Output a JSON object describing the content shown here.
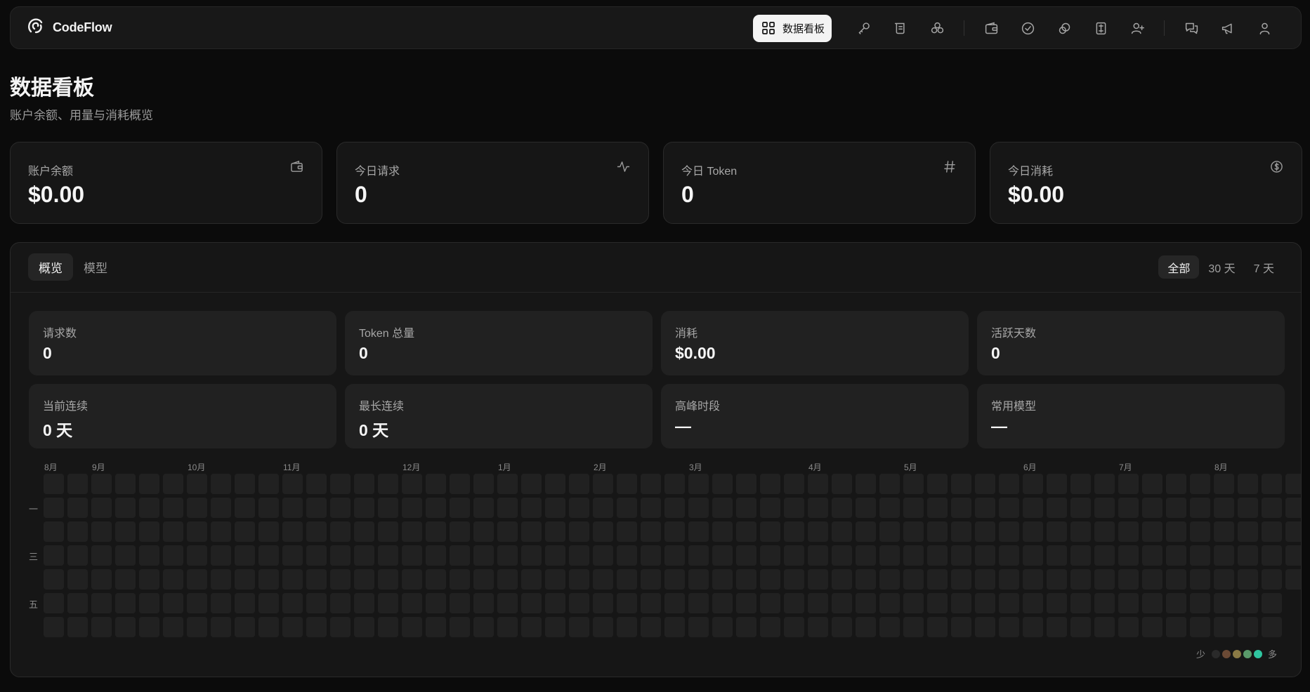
{
  "brand": {
    "name": "CodeFlow",
    "icon": "logo-icon"
  },
  "nav": {
    "active_label": "数据看板",
    "icons": [
      "key-icon",
      "scroll-icon",
      "network-icon",
      "wallet-icon",
      "check-circle-icon",
      "link-icon",
      "invoice-icon",
      "user-plus-icon",
      "chat-icon",
      "megaphone-icon",
      "user-icon"
    ]
  },
  "page": {
    "title": "数据看板",
    "subtitle": "账户余额、用量与消耗概览"
  },
  "stats": [
    {
      "label": "账户余额",
      "value": "$0.00",
      "icon": "wallet-icon"
    },
    {
      "label": "今日请求",
      "value": "0",
      "icon": "activity-icon"
    },
    {
      "label": "今日 Token",
      "value": "0",
      "icon": "hash-icon"
    },
    {
      "label": "今日消耗",
      "value": "$0.00",
      "icon": "dollar-circle-icon"
    }
  ],
  "tabs": [
    {
      "label": "概览",
      "active": true
    },
    {
      "label": "模型",
      "active": false
    }
  ],
  "ranges": [
    {
      "label": "全部",
      "active": true
    },
    {
      "label": "30 天",
      "active": false
    },
    {
      "label": "7 天",
      "active": false
    }
  ],
  "metrics": [
    {
      "label": "请求数",
      "value": "0"
    },
    {
      "label": "Token 总量",
      "value": "0"
    },
    {
      "label": "消耗",
      "value": "$0.00"
    },
    {
      "label": "活跃天数",
      "value": "0"
    },
    {
      "label": "当前连续",
      "value": "0 天"
    },
    {
      "label": "最长连续",
      "value": "0 天"
    },
    {
      "label": "高峰时段",
      "value": "—"
    },
    {
      "label": "常用模型",
      "value": "—"
    }
  ],
  "heatmap": {
    "months": [
      "8月",
      "9月",
      "10月",
      "11月",
      "12月",
      "1月",
      "2月",
      "3月",
      "4月",
      "5月",
      "6月",
      "7月",
      "8月"
    ],
    "day_labels": [
      "一",
      "三",
      "五"
    ],
    "legend_less": "少",
    "legend_more": "多",
    "legend_colors": [
      "#2a2a2a",
      "#6b4a35",
      "#8a7a45",
      "#5a9a6a",
      "#2fc6a0"
    ],
    "empty_color": "#212121"
  },
  "colors": {
    "accent": "#2fc6a0",
    "background": "#0b0b0b",
    "card": "#161616"
  }
}
